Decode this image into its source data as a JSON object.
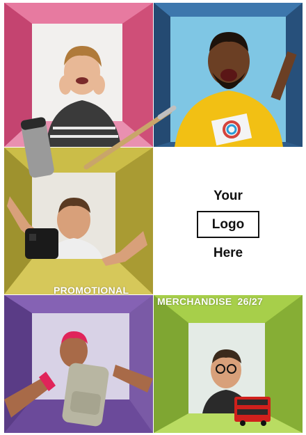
{
  "logo": {
    "line1": "Your",
    "line2": "Logo",
    "line3": "Here"
  },
  "banner": {
    "left": "PROMOTIONAL",
    "right": "MERCHANDISE",
    "year": "26/27"
  },
  "colors": {
    "pink_box": "#d9557e",
    "blue_box": "#2e5d8c",
    "olive_box": "#b6a83a",
    "purple_box": "#6b4a9a",
    "green_box": "#8fb83a",
    "text": "#111111",
    "banner_text": "#ffffff"
  }
}
